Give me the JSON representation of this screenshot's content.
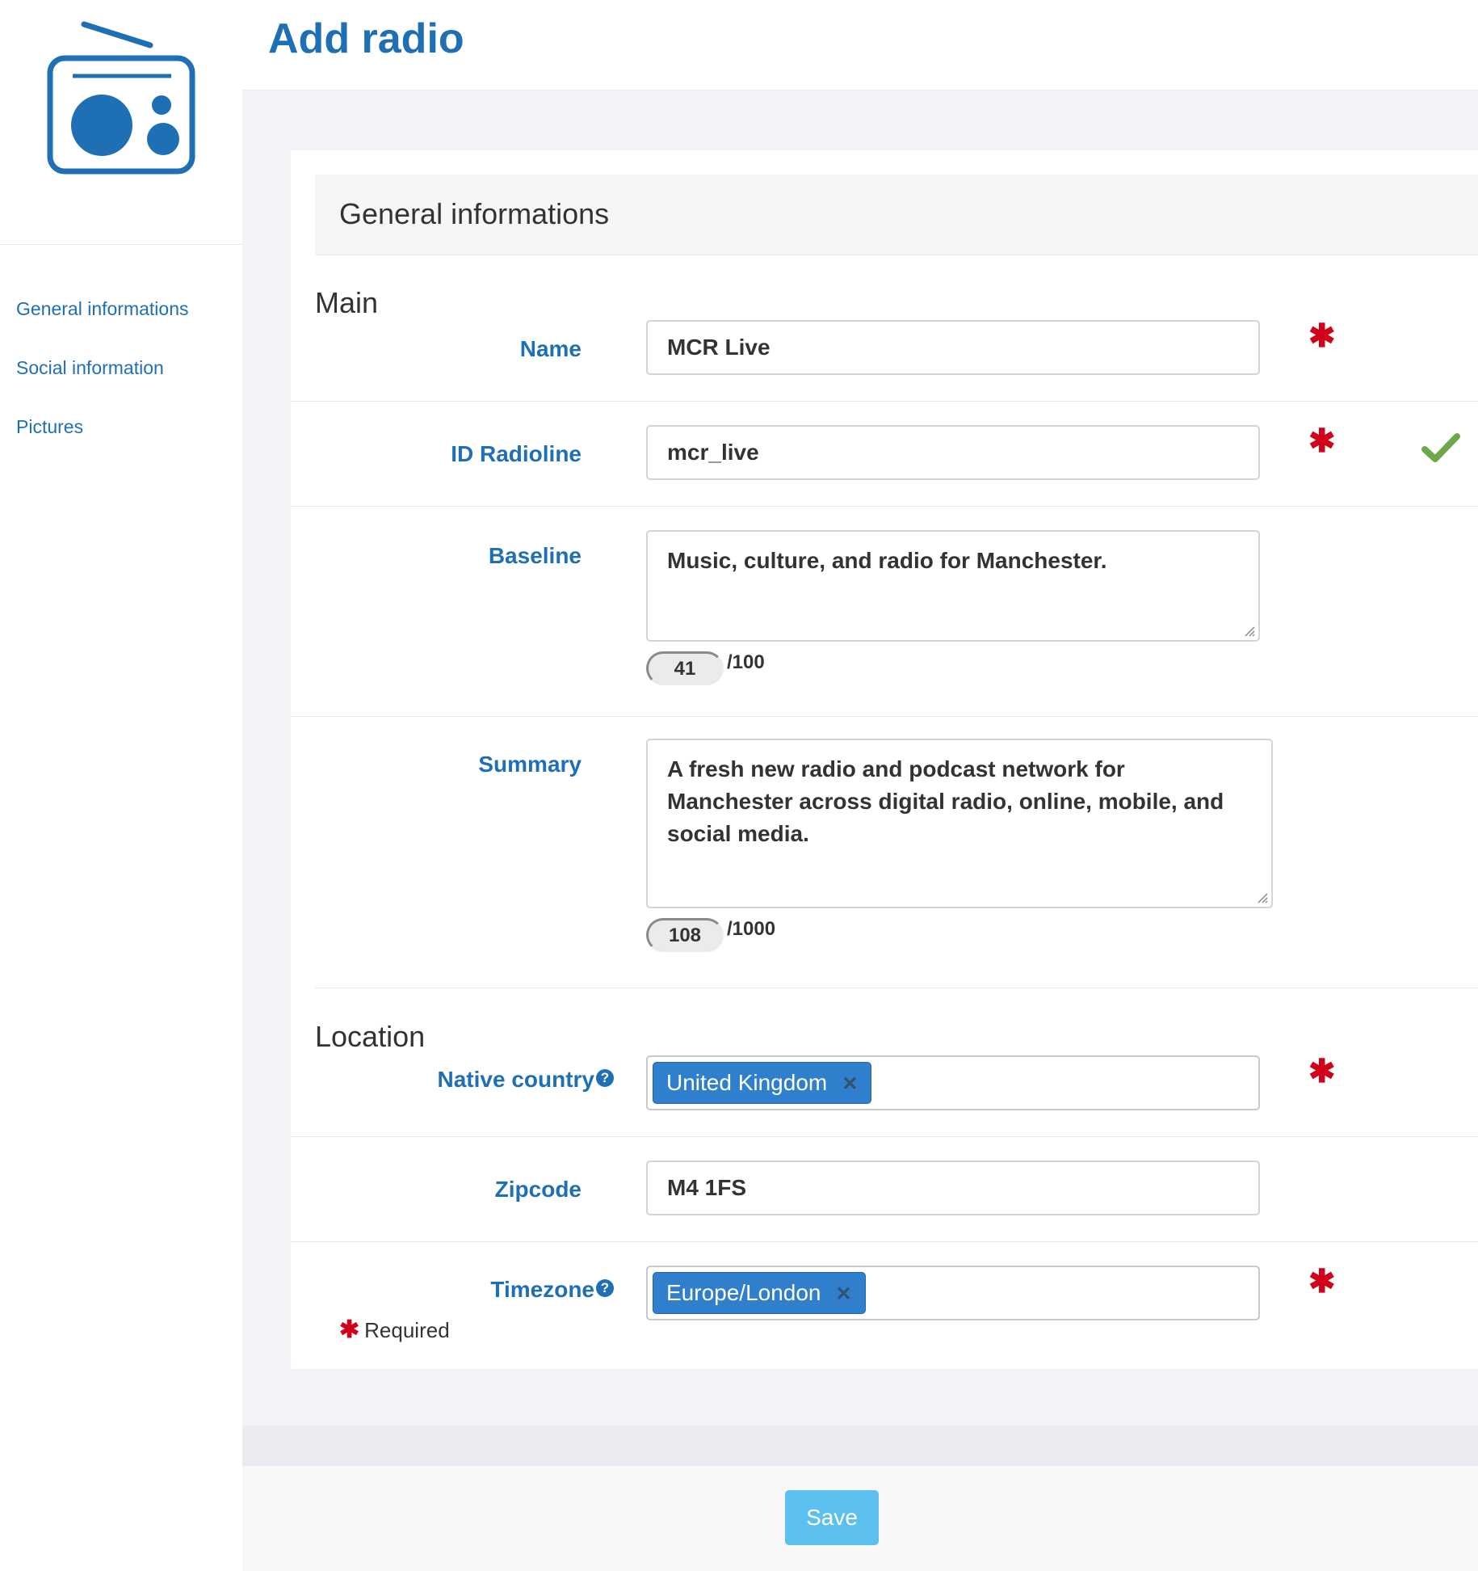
{
  "header": {
    "title": "Add radio"
  },
  "sidebar": {
    "items": [
      {
        "label": "General informations"
      },
      {
        "label": "Social information"
      },
      {
        "label": "Pictures"
      }
    ]
  },
  "card": {
    "title": "General informations"
  },
  "sections": {
    "main": "Main",
    "location": "Location"
  },
  "fields": {
    "name": {
      "label": "Name",
      "value": "MCR Live",
      "required": true
    },
    "id_radioline": {
      "label": "ID Radioline",
      "value": "mcr_live",
      "required": true,
      "valid": true
    },
    "baseline": {
      "label": "Baseline",
      "value": "Music, culture, and radio for Manchester.",
      "count": "41",
      "max": "/100"
    },
    "summary": {
      "label": "Summary",
      "value": "A fresh new radio and podcast network for Manchester across digital radio, online, mobile, and social media.",
      "count": "108",
      "max": "/1000"
    },
    "native_country": {
      "label": "Native country",
      "tag": "United Kingdom",
      "required": true
    },
    "zipcode": {
      "label": "Zipcode",
      "value": "M4 1FS"
    },
    "timezone": {
      "label": "Timezone",
      "tag": "Europe/London",
      "required": true
    }
  },
  "required_note": "Required",
  "footer": {
    "save_label": "Save"
  },
  "icons": {
    "required": "asterisk-icon",
    "valid": "check-icon",
    "help": "question-circle-icon",
    "remove": "times-icon",
    "logo": "radio-icon"
  },
  "colors": {
    "primary": "#1f6fb5",
    "required": "#d0021b",
    "valid": "#6fa84a",
    "tag": "#2f7fcc",
    "save": "#5bc0ee"
  }
}
